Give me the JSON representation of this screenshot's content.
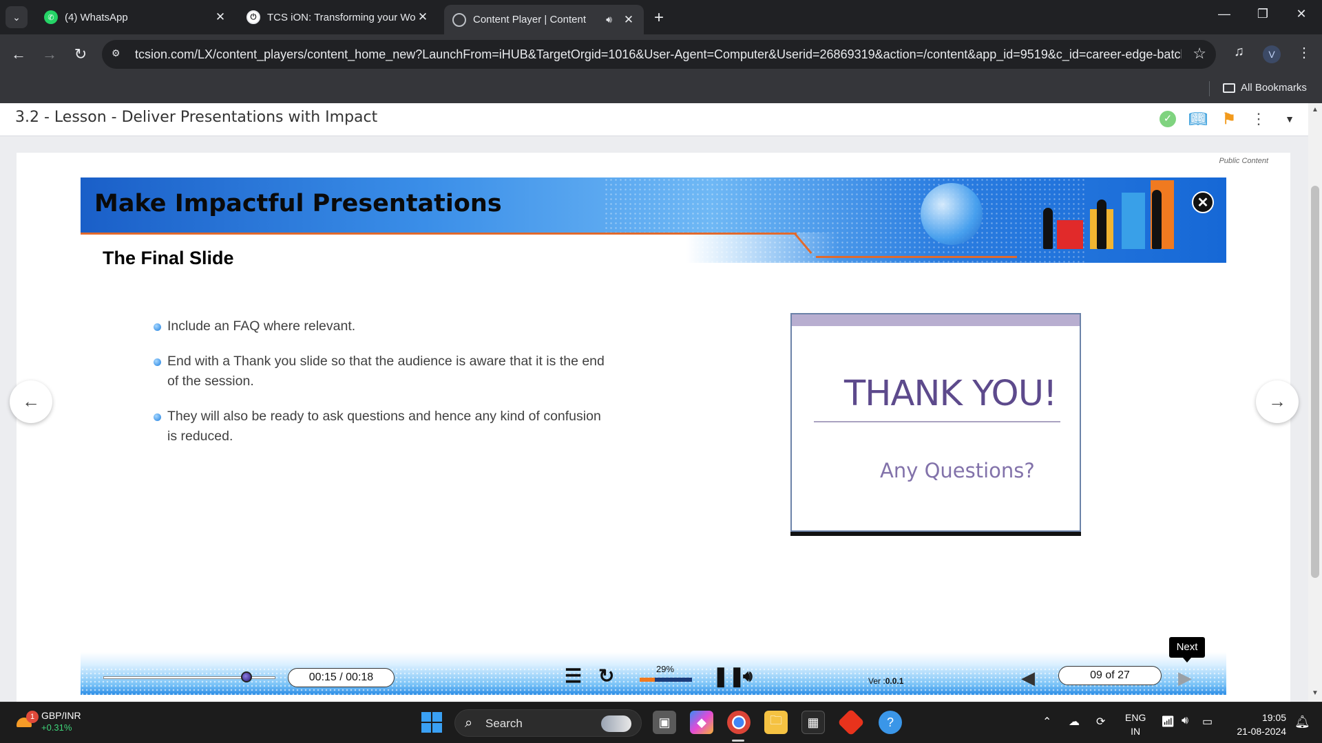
{
  "browser": {
    "tabs": [
      {
        "title": "(4) WhatsApp",
        "favicon": "whatsapp-icon",
        "active": false
      },
      {
        "title": "TCS iON: Transforming your Wo",
        "favicon": "tcs-ion-icon",
        "active": false
      },
      {
        "title": "Content Player | Content",
        "favicon": "globe-icon",
        "active": true,
        "audio": true
      }
    ],
    "url": "tcsion.com/LX/content_players/content_home_new?LaunchFrom=iHUB&TargetOrgid=1016&User-Agent=Computer&Userid=26869319&action=/content&app_id=9519&c_id=career-edge-batch...",
    "profile_initial": "V",
    "bookmarks_label": "All Bookmarks"
  },
  "lesson": {
    "title": "3.2 - Lesson - Deliver Presentations with Impact",
    "public_label": "Public Content"
  },
  "slide": {
    "title": "Make Impactful Presentations",
    "subtitle": "The Final Slide",
    "bullets": [
      "Include an FAQ where relevant.",
      "End with a Thank you slide so that the audience is aware that it is the end of the session.",
      "They will also be ready to ask questions and hence any kind of confusion is reduced."
    ],
    "thank_you": {
      "title": "THANK YOU!",
      "subtitle": "Any Questions?"
    }
  },
  "player": {
    "time": "00:15 / 00:18",
    "progress": 0.83,
    "volume_pct": "29%",
    "version_label": "Ver :",
    "version": "0.0.1",
    "page": "09 of 27",
    "next_tooltip": "Next"
  },
  "taskbar": {
    "widget_name": "GBP/INR",
    "widget_change": "+0.31%",
    "widget_badge": "1",
    "search_label": "Search",
    "lang_line1": "ENG",
    "lang_line2": "IN",
    "time": "19:05",
    "date": "21-08-2024"
  },
  "colors": {
    "accent_purple": "#5d4a8c",
    "banner_blue": "#2b7de0",
    "orange_line": "#e26a2c"
  }
}
